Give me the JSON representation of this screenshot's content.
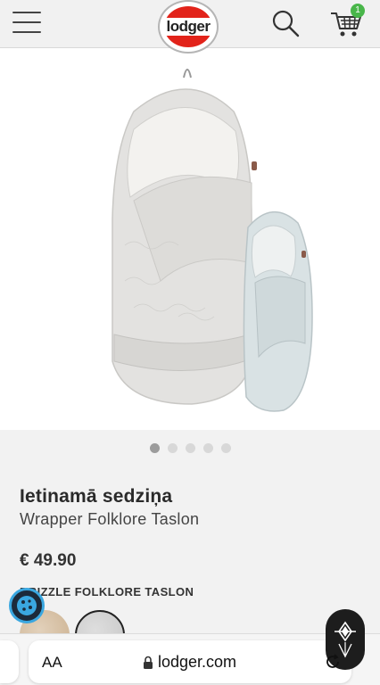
{
  "header": {
    "logo_text": "lodger",
    "cart_count": "1",
    "accent_color": "#e2231a",
    "badge_color": "#49b64a",
    "icons": [
      "menu-icon",
      "search-icon",
      "cart-icon"
    ]
  },
  "gallery": {
    "slides": [
      "slide-1",
      "slide-2",
      "slide-3",
      "slide-4",
      "slide-5"
    ],
    "active_slide": 1
  },
  "product": {
    "title": "Ietinamā sedziņa",
    "subtitle": "Wrapper Folklore Taslon",
    "price": "€ 49.90",
    "variant_label": "DRIZZLE FOLKLORE TASLON",
    "swatches": [
      {
        "color": "#d9c4a8"
      },
      {
        "color": "#d4d4d4",
        "selected": true
      }
    ]
  },
  "browser": {
    "aa_label": "AA",
    "url": "lodger.com"
  }
}
